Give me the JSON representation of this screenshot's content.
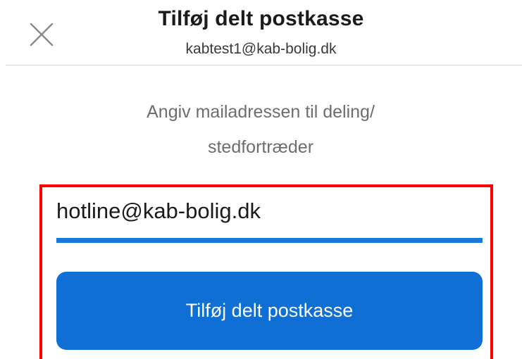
{
  "header": {
    "title": "Tilføj delt postkasse",
    "account": "kabtest1@kab-bolig.dk",
    "close_icon": "close-icon"
  },
  "main": {
    "instruction_line1": "Angiv mailadressen til deling/",
    "instruction_line2": "stedfortræder",
    "email_value": "hotline@kab-bolig.dk",
    "submit_label": "Tilføj delt postkasse"
  },
  "colors": {
    "accent": "#0f6fd4",
    "underline": "#1a78d6",
    "highlight": "#ff0000"
  }
}
